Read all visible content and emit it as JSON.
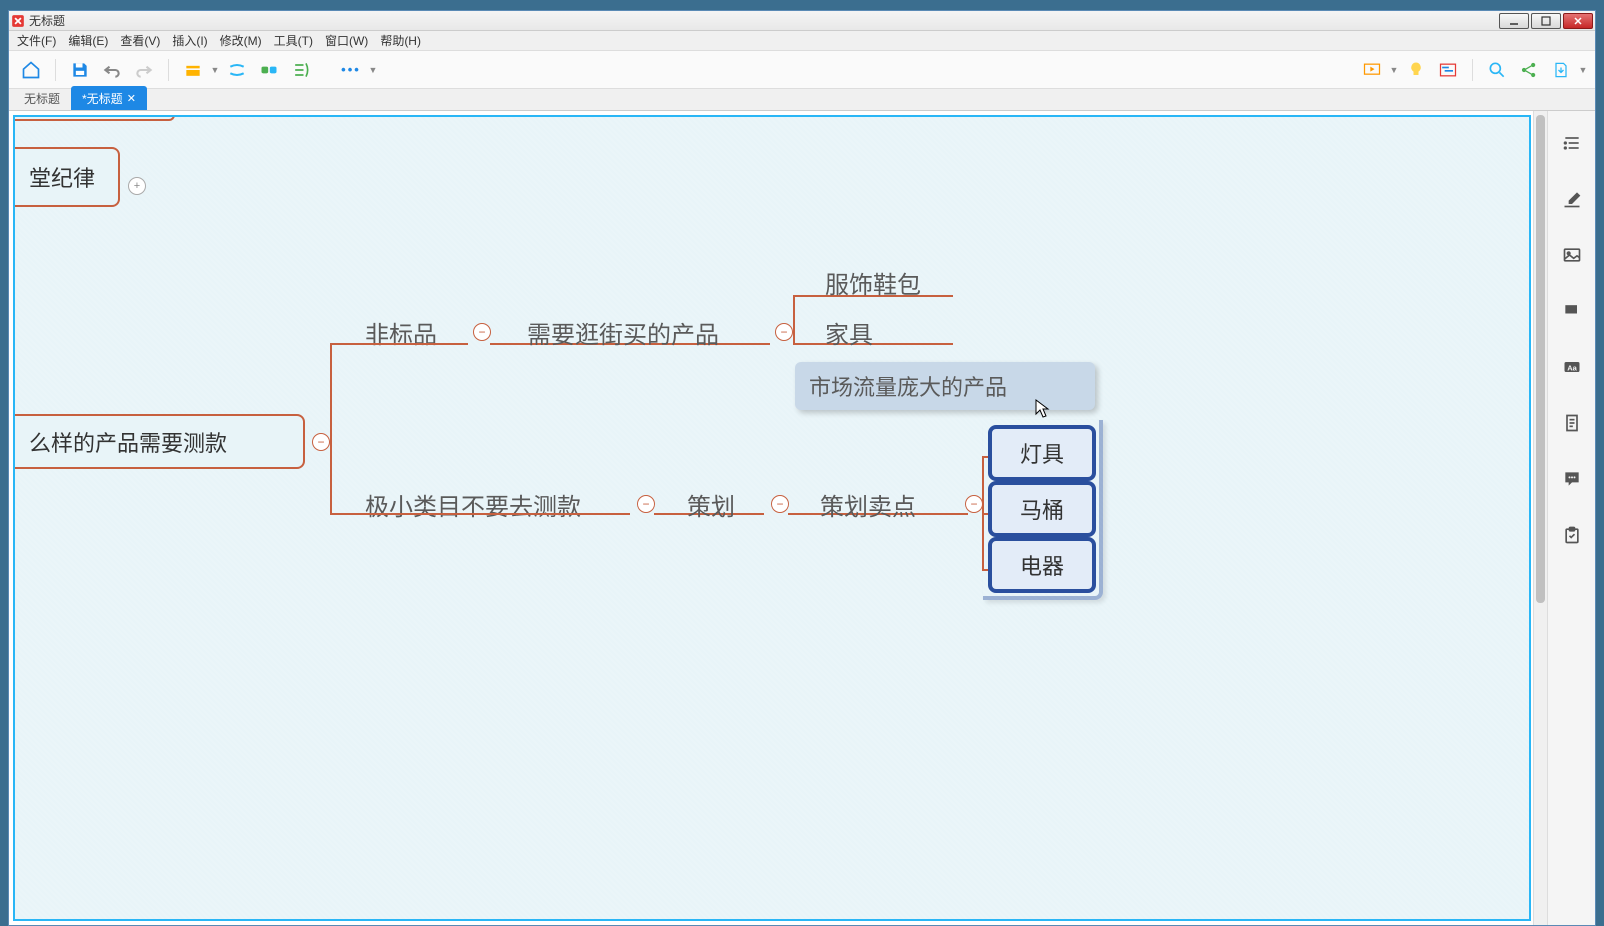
{
  "window": {
    "title": "无标题"
  },
  "menubar": [
    "文件(F)",
    "编辑(E)",
    "查看(V)",
    "插入(I)",
    "修改(M)",
    "工具(T)",
    "窗口(W)",
    "帮助(H)"
  ],
  "tabs": [
    {
      "label": "无标题",
      "active": false
    },
    {
      "label": "*无标题",
      "active": true
    }
  ],
  "nodes": {
    "topPartial": "堂纪律",
    "mainPartial": "么样的产品需要测款",
    "branch1": "非标品",
    "branch1_1": "需要逛街买的产品",
    "branch1_1_1": "服饰鞋包",
    "branch1_1_2": "家具",
    "dragFloat": "市场流量庞大的产品",
    "branch2": "极小类目不要去测款",
    "branch2_1": "策划",
    "branch2_2": "策划卖点",
    "blue1": "灯具",
    "blue2": "马桶",
    "blue3": "电器"
  },
  "icons": {
    "expand": "+",
    "collapse": "−"
  }
}
